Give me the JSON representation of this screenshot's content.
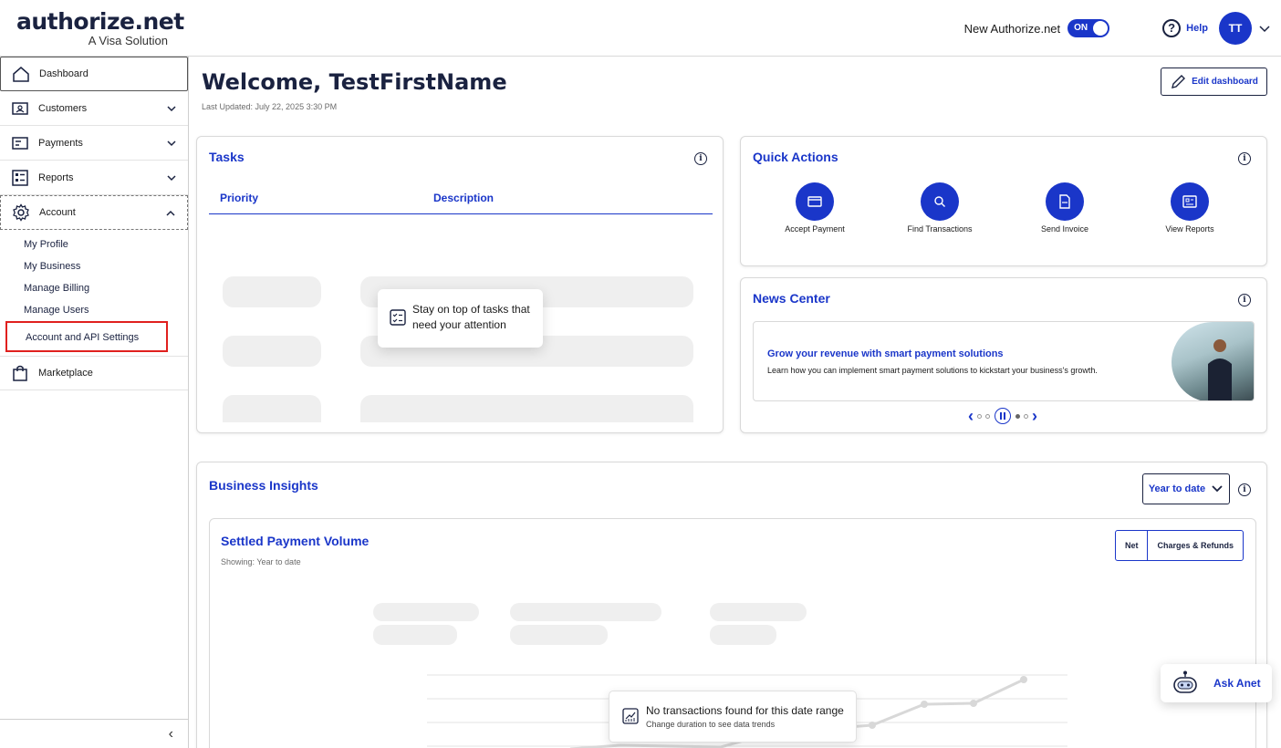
{
  "brand": {
    "name": "authorize.net",
    "tagline": "A Visa Solution"
  },
  "header": {
    "new_toggle_label": "New Authorize.net",
    "toggle_state": "ON",
    "help_label": "Help",
    "avatar_initials": "TT"
  },
  "sidebar": {
    "items": [
      {
        "label": "Dashboard"
      },
      {
        "label": "Customers"
      },
      {
        "label": "Payments"
      },
      {
        "label": "Reports"
      },
      {
        "label": "Account"
      }
    ],
    "account_sub": [
      "My Profile",
      "My Business",
      "Manage Billing",
      "Manage Users",
      "Account and API Settings"
    ],
    "marketplace": "Marketplace",
    "collapse": "‹"
  },
  "main": {
    "welcome": "Welcome, TestFirstName",
    "last_updated": "Last Updated: July 22, 2025 3:30 PM",
    "edit_dashboard": "Edit dashboard"
  },
  "tasks": {
    "title": "Tasks",
    "col_priority": "Priority",
    "col_description": "Description",
    "empty_msg": "Stay on top of tasks that need your attention"
  },
  "quick_actions": {
    "title": "Quick Actions",
    "items": [
      "Accept Payment",
      "Find Transactions",
      "Send Invoice",
      "View Reports"
    ]
  },
  "news": {
    "title": "News Center",
    "headline": "Grow your revenue with smart payment solutions",
    "body": "Learn how you can implement smart payment solutions to kickstart your business's growth."
  },
  "insights": {
    "title": "Business Insights",
    "range": "Year to date",
    "chart_title": "Settled Payment Volume",
    "showing": "Showing: Year to date",
    "seg_net": "Net",
    "seg_charges": "Charges & Refunds",
    "no_tx_title": "No transactions found for this date range",
    "no_tx_sub": "Change duration to see data trends"
  },
  "assistant": {
    "label": "Ask Anet"
  },
  "colors": {
    "primary": "#1a36c9",
    "navy": "#1a2240",
    "highlight": "#e0201e"
  }
}
